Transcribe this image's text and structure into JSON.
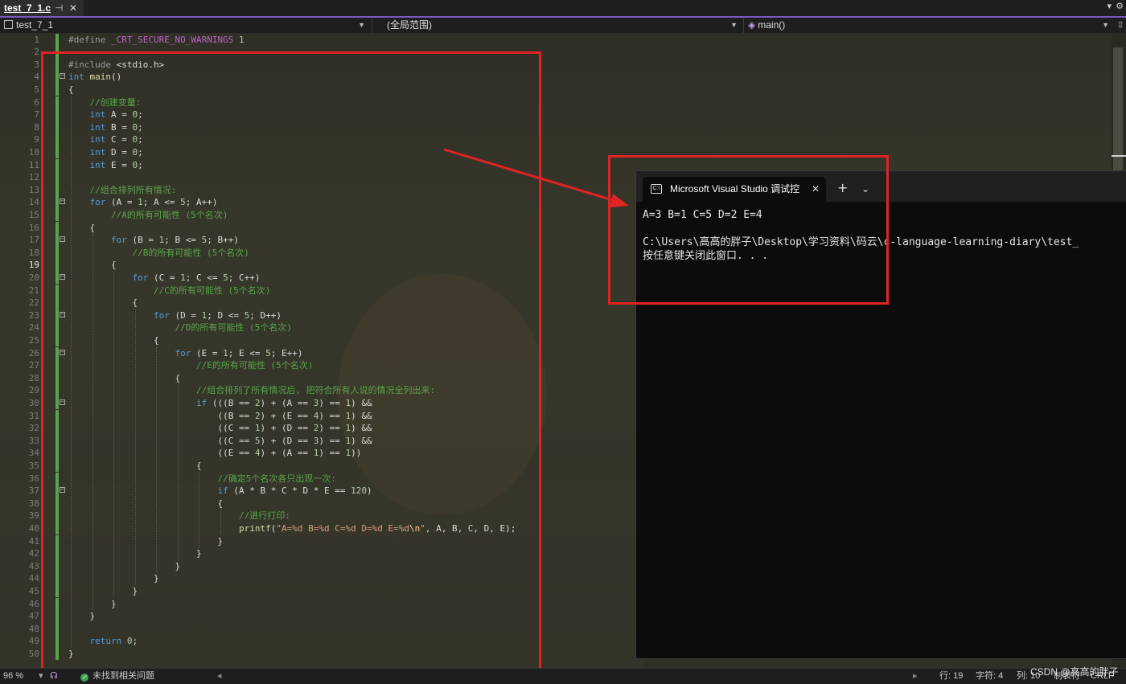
{
  "tab": {
    "filename": "test_7_1.c",
    "pin": "⊣",
    "close": "✕"
  },
  "navbar": {
    "project": "test_7_1",
    "scope": "(全局范围)",
    "function": "main()"
  },
  "editor": {
    "current_line": 19,
    "lines": [
      {
        "n": 1,
        "indent": 0,
        "text": "#define _CRT_SECURE_NO_WARNINGS 1",
        "type": "pre"
      },
      {
        "n": 2,
        "indent": 0,
        "text": "",
        "type": "code"
      },
      {
        "n": 3,
        "indent": 0,
        "text": "#include <stdio.h>",
        "type": "pre"
      },
      {
        "n": 4,
        "indent": 0,
        "text": "int main()",
        "type": "code",
        "fold": true
      },
      {
        "n": 5,
        "indent": 0,
        "text": "{",
        "type": "code"
      },
      {
        "n": 6,
        "indent": 1,
        "text": "//创建变量:",
        "type": "comment"
      },
      {
        "n": 7,
        "indent": 1,
        "text": "int A = 0;",
        "type": "code"
      },
      {
        "n": 8,
        "indent": 1,
        "text": "int B = 0;",
        "type": "code"
      },
      {
        "n": 9,
        "indent": 1,
        "text": "int C = 0;",
        "type": "code"
      },
      {
        "n": 10,
        "indent": 1,
        "text": "int D = 0;",
        "type": "code"
      },
      {
        "n": 11,
        "indent": 1,
        "text": "int E = 0;",
        "type": "code"
      },
      {
        "n": 12,
        "indent": 0,
        "text": "",
        "type": "code"
      },
      {
        "n": 13,
        "indent": 1,
        "text": "//组合排列所有情况:",
        "type": "comment"
      },
      {
        "n": 14,
        "indent": 1,
        "text": "for (A = 1; A <= 5; A++)",
        "type": "code",
        "fold": true
      },
      {
        "n": 15,
        "indent": 2,
        "text": "//A的所有可能性 (5个名次)",
        "type": "comment"
      },
      {
        "n": 16,
        "indent": 1,
        "text": "{",
        "type": "code"
      },
      {
        "n": 17,
        "indent": 2,
        "text": "for (B = 1; B <= 5; B++)",
        "type": "code",
        "fold": true
      },
      {
        "n": 18,
        "indent": 3,
        "text": "//B的所有可能性 (5个名次)",
        "type": "comment"
      },
      {
        "n": 19,
        "indent": 2,
        "text": "{",
        "type": "code"
      },
      {
        "n": 20,
        "indent": 3,
        "text": "for (C = 1; C <= 5; C++)",
        "type": "code",
        "fold": true
      },
      {
        "n": 21,
        "indent": 4,
        "text": "//C的所有可能性 (5个名次)",
        "type": "comment"
      },
      {
        "n": 22,
        "indent": 3,
        "text": "{",
        "type": "code"
      },
      {
        "n": 23,
        "indent": 4,
        "text": "for (D = 1; D <= 5; D++)",
        "type": "code",
        "fold": true
      },
      {
        "n": 24,
        "indent": 5,
        "text": "//D的所有可能性 (5个名次)",
        "type": "comment"
      },
      {
        "n": 25,
        "indent": 4,
        "text": "{",
        "type": "code"
      },
      {
        "n": 26,
        "indent": 5,
        "text": "for (E = 1; E <= 5; E++)",
        "type": "code",
        "fold": true
      },
      {
        "n": 27,
        "indent": 6,
        "text": "//E的所有可能性 (5个名次)",
        "type": "comment"
      },
      {
        "n": 28,
        "indent": 5,
        "text": "{",
        "type": "code"
      },
      {
        "n": 29,
        "indent": 6,
        "text": "//组合排列了所有情况后, 把符合所有人说的情况全列出来:",
        "type": "comment"
      },
      {
        "n": 30,
        "indent": 6,
        "text": "if (((B == 2) + (A == 3) == 1) &&",
        "type": "code",
        "fold": true
      },
      {
        "n": 31,
        "indent": 7,
        "text": "((B == 2) + (E == 4) == 1) &&",
        "type": "code"
      },
      {
        "n": 32,
        "indent": 7,
        "text": "((C == 1) + (D == 2) == 1) &&",
        "type": "code"
      },
      {
        "n": 33,
        "indent": 7,
        "text": "((C == 5) + (D == 3) == 1) &&",
        "type": "code"
      },
      {
        "n": 34,
        "indent": 7,
        "text": "((E == 4) + (A == 1) == 1))",
        "type": "code"
      },
      {
        "n": 35,
        "indent": 6,
        "text": "{",
        "type": "code"
      },
      {
        "n": 36,
        "indent": 7,
        "text": "//确定5个名次各只出现一次:",
        "type": "comment"
      },
      {
        "n": 37,
        "indent": 7,
        "text": "if (A * B * C * D * E == 120)",
        "type": "code",
        "fold": true
      },
      {
        "n": 38,
        "indent": 7,
        "text": "{",
        "type": "code"
      },
      {
        "n": 39,
        "indent": 8,
        "text": "//进行打印:",
        "type": "comment"
      },
      {
        "n": 40,
        "indent": 8,
        "text": "printf(\"A=%d B=%d C=%d D=%d E=%d\\n\", A, B, C, D, E);",
        "type": "code"
      },
      {
        "n": 41,
        "indent": 7,
        "text": "}",
        "type": "code"
      },
      {
        "n": 42,
        "indent": 6,
        "text": "}",
        "type": "code"
      },
      {
        "n": 43,
        "indent": 5,
        "text": "}",
        "type": "code"
      },
      {
        "n": 44,
        "indent": 4,
        "text": "}",
        "type": "code"
      },
      {
        "n": 45,
        "indent": 3,
        "text": "}",
        "type": "code"
      },
      {
        "n": 46,
        "indent": 2,
        "text": "}",
        "type": "code"
      },
      {
        "n": 47,
        "indent": 1,
        "text": "}",
        "type": "code"
      },
      {
        "n": 48,
        "indent": 0,
        "text": "",
        "type": "code"
      },
      {
        "n": 49,
        "indent": 1,
        "text": "return 0;",
        "type": "code"
      },
      {
        "n": 50,
        "indent": 0,
        "text": "}",
        "type": "code"
      }
    ]
  },
  "console": {
    "title": "Microsoft Visual Studio 调试控",
    "output_line1": "A=3 B=1 C=5 D=2 E=4",
    "output_line2": "C:\\Users\\高高的胖子\\Desktop\\学习资料\\码云\\c-language-learning-diary\\test_",
    "output_line3": "按任意键关闭此窗口. . ."
  },
  "status": {
    "zoom": "96 %",
    "issues": "未找到相关问题",
    "line": "行: 19",
    "char": "字符: 4",
    "col": "列: 10",
    "tab": "制表符",
    "eol": "CRLF",
    "watermark": "CSDN @高高的胖子"
  },
  "colors": {
    "annotation_red": "#e02323",
    "comment_green": "#57a64a",
    "keyword_blue": "#569cd6"
  }
}
